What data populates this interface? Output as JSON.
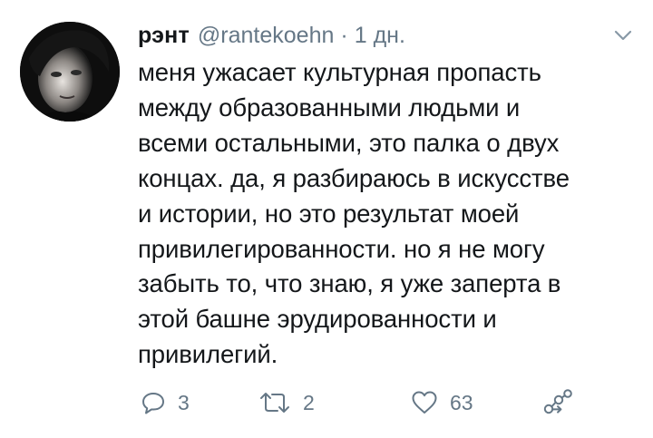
{
  "tweet": {
    "display_name": "рэнт",
    "handle": "@rantekoehn",
    "separator": "·",
    "time": "1 дн.",
    "text": "меня ужасает культурная пропасть\nмежду образованными людьми и\nвсеми остальными, это палка о двух\nконцах. да, я разбираюсь в искусстве\nи истории, но это результат моей\nпривилегированности. но я не могу\nзабыть то, что знаю, я уже заперта в\nэтой башне эрудированности и\nпривилегий.",
    "actions": {
      "reply": {
        "icon": "reply-icon",
        "count": "3"
      },
      "retweet": {
        "icon": "retweet-icon",
        "count": "2"
      },
      "like": {
        "icon": "heart-icon",
        "count": "63"
      },
      "share": {
        "icon": "share-icon"
      }
    },
    "menu": {
      "icon": "chevron-down-icon"
    }
  },
  "colors": {
    "text_primary": "#14171a",
    "text_secondary": "#657786",
    "background": "#ffffff"
  }
}
